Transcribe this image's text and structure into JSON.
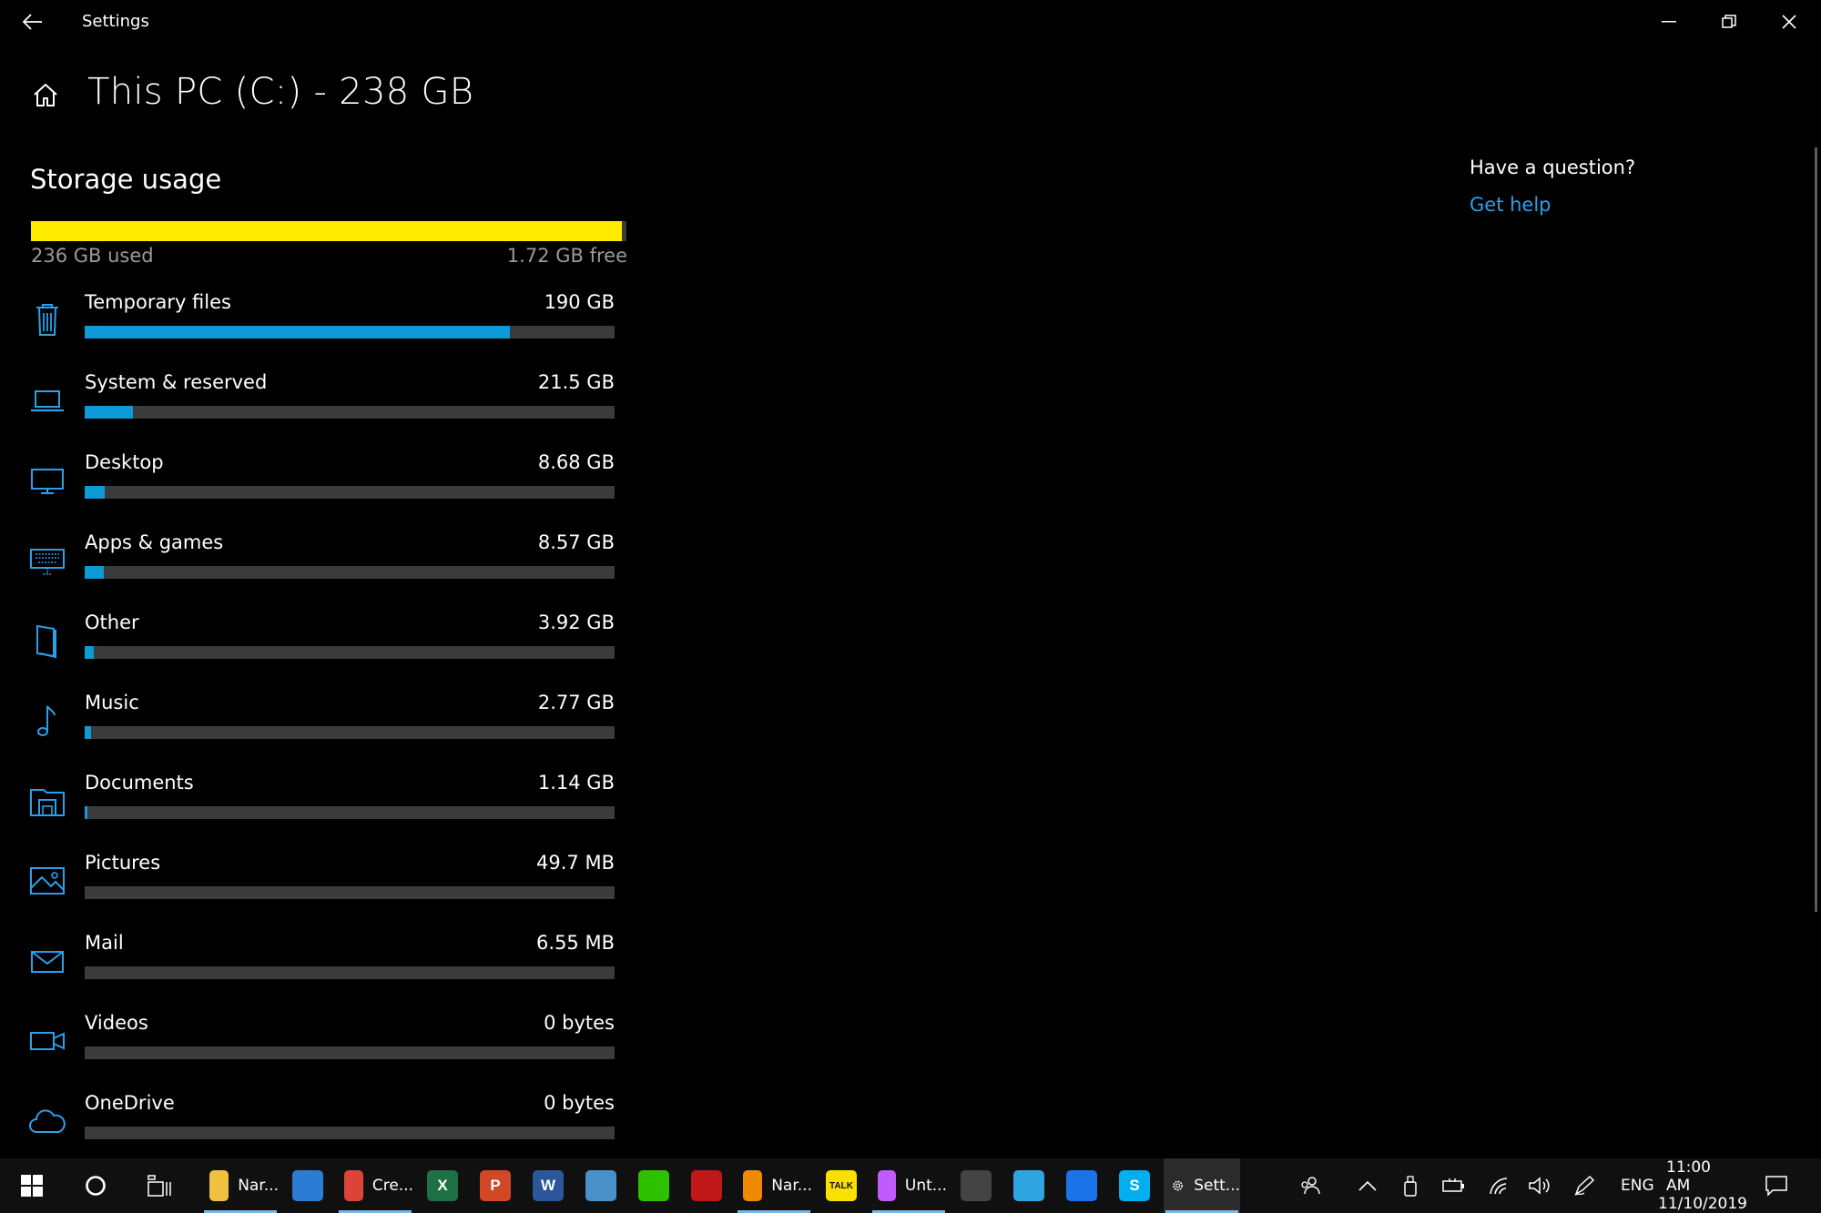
{
  "window": {
    "title": "Settings",
    "back_icon": "back-arrow-icon",
    "controls": {
      "minimize_icon": "minimize-icon",
      "restore_icon": "restore-icon",
      "close_icon": "close-icon"
    }
  },
  "header": {
    "home_icon": "home-icon",
    "title": "This PC (C:) - 238 GB"
  },
  "storage": {
    "section_title": "Storage usage",
    "used_label": "236 GB used",
    "free_label": "1.72 GB free",
    "used_fraction": 0.992,
    "bar_color": "#ffeb00",
    "fill_color": "#0d9ad6",
    "categories": [
      {
        "name": "Temporary files",
        "size": "190 GB",
        "fraction": 0.803,
        "icon": "trash-icon"
      },
      {
        "name": "System & reserved",
        "size": "21.5 GB",
        "fraction": 0.091,
        "icon": "laptop-icon"
      },
      {
        "name": "Desktop",
        "size": "8.68 GB",
        "fraction": 0.037,
        "icon": "monitor-icon"
      },
      {
        "name": "Apps & games",
        "size": "8.57 GB",
        "fraction": 0.036,
        "icon": "keyboard-icon"
      },
      {
        "name": "Other",
        "size": "3.92 GB",
        "fraction": 0.017,
        "icon": "file-icon"
      },
      {
        "name": "Music",
        "size": "2.77 GB",
        "fraction": 0.012,
        "icon": "music-note-icon"
      },
      {
        "name": "Documents",
        "size": "1.14 GB",
        "fraction": 0.005,
        "icon": "documents-icon"
      },
      {
        "name": "Pictures",
        "size": "49.7 MB",
        "fraction": 0.0,
        "icon": "picture-icon"
      },
      {
        "name": "Mail",
        "size": "6.55 MB",
        "fraction": 0.0,
        "icon": "mail-icon"
      },
      {
        "name": "Videos",
        "size": "0 bytes",
        "fraction": 0.0,
        "icon": "video-camera-icon"
      },
      {
        "name": "OneDrive",
        "size": "0 bytes",
        "fraction": 0.0,
        "icon": "cloud-icon"
      }
    ]
  },
  "help": {
    "title": "Have a question?",
    "link": "Get help",
    "link_color": "#2aa0ea"
  },
  "taskbar": {
    "start_icon": "windows-start-icon",
    "search_icon": "cortana-circle-icon",
    "taskview_icon": "task-view-icon",
    "apps": [
      {
        "icon": "file-explorer-icon",
        "label": "Nar...",
        "color": "#f0c040",
        "active": true
      },
      {
        "icon": "store-icon",
        "label": "",
        "color": "#2b7cd3",
        "active": false
      },
      {
        "icon": "chrome-icon",
        "label": "Cre...",
        "color": "#db4437",
        "active": true
      },
      {
        "icon": "excel-icon",
        "label": "",
        "color": "#1e7145",
        "glyph": "X",
        "active": false
      },
      {
        "icon": "powerpoint-icon",
        "label": "",
        "color": "#d24726",
        "glyph": "P",
        "active": false
      },
      {
        "icon": "word-icon",
        "label": "",
        "color": "#2b579a",
        "glyph": "W",
        "active": false
      },
      {
        "icon": "water-drop-icon",
        "label": "",
        "color": "#4a90c8",
        "active": false
      },
      {
        "icon": "wechat-icon",
        "label": "",
        "color": "#2dc100",
        "active": false
      },
      {
        "icon": "mcafee-icon",
        "label": "",
        "color": "#c01818",
        "active": false
      },
      {
        "icon": "vlc-icon",
        "label": "Nar...",
        "color": "#f08a00",
        "active": true
      },
      {
        "icon": "kakaotalk-icon",
        "label": "",
        "color": "#f9e000",
        "glyph": "TALK",
        "active": false
      },
      {
        "icon": "paint3d-icon",
        "label": "Unt...",
        "color": "#c05cff",
        "active": true
      },
      {
        "icon": "calculator-icon",
        "label": "",
        "color": "#444444",
        "active": false
      },
      {
        "icon": "telegram-icon",
        "label": "",
        "color": "#2ca5e0",
        "active": false
      },
      {
        "icon": "security-shield-icon",
        "label": "",
        "color": "#1a73e8",
        "active": false
      },
      {
        "icon": "skype-icon",
        "label": "",
        "color": "#00aff0",
        "glyph": "S",
        "active": false
      },
      {
        "icon": "settings-gear-icon",
        "label": "Sett...",
        "color": "#ffffff",
        "active": true,
        "selected": true
      }
    ],
    "tray": {
      "people_icon": "people-icon",
      "chevron_icon": "chevron-up-icon",
      "usb_icon": "usb-drive-icon",
      "battery_icon": "battery-icon",
      "wifi_icon": "wifi-icon",
      "volume_icon": "volume-icon",
      "pen_icon": "pen-icon",
      "language": "ENG",
      "time": "11:00 AM",
      "date": "11/10/2019",
      "notification_icon": "notification-icon"
    }
  }
}
